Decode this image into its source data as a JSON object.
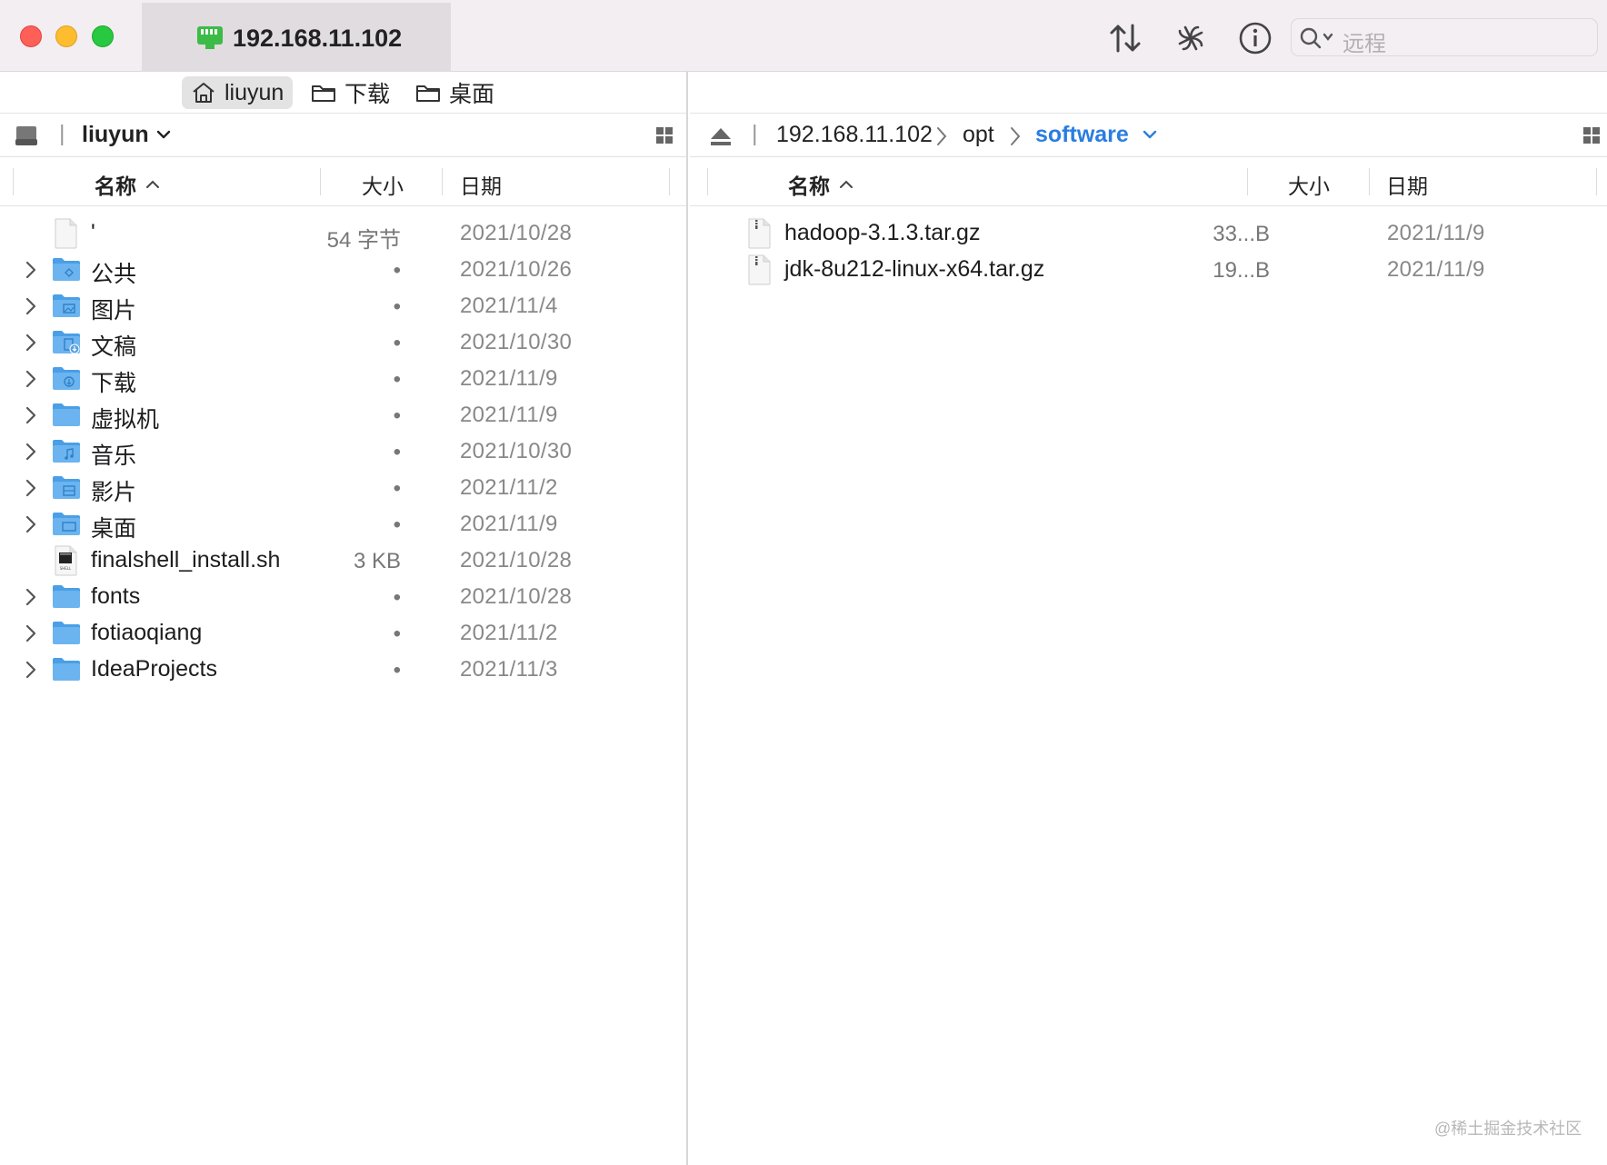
{
  "window": {
    "tab_title": "192.168.11.102",
    "search_placeholder": "远程"
  },
  "left": {
    "favorites": [
      {
        "label": "liuyun",
        "icon": "home-icon",
        "active": true
      },
      {
        "label": "下载",
        "icon": "folder-icon",
        "active": false
      },
      {
        "label": "桌面",
        "icon": "folder-icon",
        "active": false
      }
    ],
    "path": {
      "label": "liuyun"
    },
    "columns": {
      "name": "名称",
      "size": "大小",
      "date": "日期"
    },
    "rows": [
      {
        "name": "'",
        "size": "54 字节",
        "date": "2021/10/28",
        "kind": "file-blank",
        "expandable": false
      },
      {
        "name": "公共",
        "size": "•",
        "date": "2021/10/26",
        "kind": "folder-public",
        "expandable": true
      },
      {
        "name": "图片",
        "size": "•",
        "date": "2021/11/4",
        "kind": "folder-pictures",
        "expandable": true
      },
      {
        "name": "文稿",
        "size": "•",
        "date": "2021/10/30",
        "kind": "folder-documents",
        "expandable": true
      },
      {
        "name": "下载",
        "size": "•",
        "date": "2021/11/9",
        "kind": "folder-downloads",
        "expandable": true
      },
      {
        "name": "虚拟机",
        "size": "•",
        "date": "2021/11/9",
        "kind": "folder",
        "expandable": true
      },
      {
        "name": "音乐",
        "size": "•",
        "date": "2021/10/30",
        "kind": "folder-music",
        "expandable": true
      },
      {
        "name": "影片",
        "size": "•",
        "date": "2021/11/2",
        "kind": "folder-movies",
        "expandable": true
      },
      {
        "name": "桌面",
        "size": "•",
        "date": "2021/11/9",
        "kind": "folder-desktop",
        "expandable": true
      },
      {
        "name": "finalshell_install.sh",
        "size": "3 KB",
        "date": "2021/10/28",
        "kind": "file-shell",
        "expandable": false
      },
      {
        "name": "fonts",
        "size": "•",
        "date": "2021/10/28",
        "kind": "folder",
        "expandable": true
      },
      {
        "name": "fotiaoqiang",
        "size": "•",
        "date": "2021/11/2",
        "kind": "folder",
        "expandable": true
      },
      {
        "name": "IdeaProjects",
        "size": "•",
        "date": "2021/11/3",
        "kind": "folder",
        "expandable": true
      }
    ]
  },
  "right": {
    "path": [
      "192.168.11.102",
      "opt",
      "software"
    ],
    "columns": {
      "name": "名称",
      "size": "大小",
      "date": "日期"
    },
    "rows": [
      {
        "name": "hadoop-3.1.3.tar.gz",
        "size": "33...B",
        "date": "2021/11/9",
        "kind": "file-archive"
      },
      {
        "name": "jdk-8u212-linux-x64.tar.gz",
        "size": "19...B",
        "date": "2021/11/9",
        "kind": "file-archive"
      }
    ]
  },
  "watermark": "@稀土掘金技术社区",
  "colors": {
    "accent": "#2a7de1",
    "folder": "#6cb4ef",
    "network_icon": "#3dbb47"
  }
}
